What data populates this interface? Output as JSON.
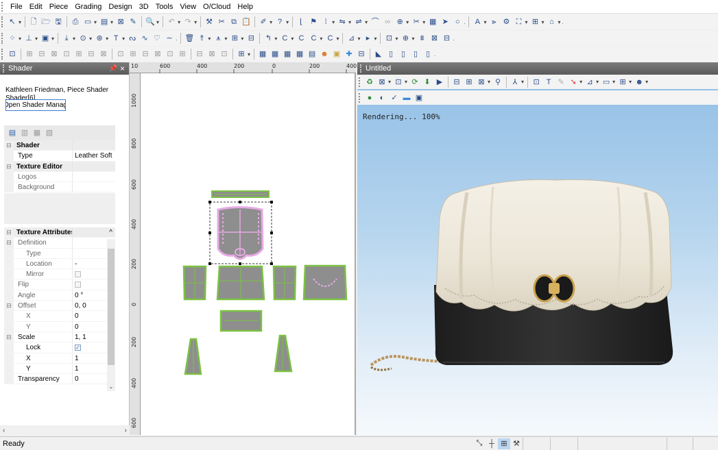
{
  "menu": {
    "items": [
      "File",
      "Edit",
      "Piece",
      "Grading",
      "Design",
      "3D",
      "Tools",
      "View",
      "O/Cloud",
      "Help"
    ]
  },
  "shader_panel": {
    "title": "Shader",
    "pin_icon": "pin-icon",
    "close_icon": "close-icon",
    "piece_title": "Kathleen Friedman, Piece Shader Shader[6]",
    "open_shader_value": "Open Shader Manager",
    "properties": {
      "shader_category": "Shader",
      "type_label": "Type",
      "type_value": "Leather Soft",
      "texture_editor_category": "Texture Editor",
      "logos_label": "Logos",
      "background_label": "Background"
    },
    "texture_attributes": {
      "category": "Texture Attributes",
      "definition": "Definition",
      "type": "Type",
      "location": "Location",
      "location_value": "-",
      "mirror": "Mirror",
      "flip": "Flip",
      "angle": "Angle",
      "angle_value": "0 °",
      "offset": "Offset",
      "offset_value": "0, 0",
      "offset_x": "X",
      "offset_x_value": "0",
      "offset_y": "Y",
      "offset_y_value": "0",
      "scale": "Scale",
      "scale_value": "1, 1",
      "lock": "Lock",
      "scale_x": "X",
      "scale_x_value": "1",
      "scale_y": "Y",
      "scale_y_value": "1",
      "transparency": "Transparency",
      "transparency_value": "0"
    }
  },
  "view2d": {
    "ruler_top_labels": [
      "10",
      "600",
      "400",
      "200",
      "0",
      "200",
      "400"
    ],
    "ruler_left_labels": [
      "1000",
      "800",
      "600",
      "400",
      "200",
      "0",
      "200",
      "400",
      "600"
    ]
  },
  "view3d": {
    "title": "Untitled",
    "render_status": "Rendering... 100%"
  },
  "status_bar": {
    "text": "Ready"
  },
  "colors": {
    "panel_header": "#6a6a6a",
    "piece_fill": "#8e8e8e",
    "piece_outline": "#7cc242",
    "selection_pink": "#e7a9e4",
    "bag_flap": "#ece7dc",
    "bag_body": "#262626",
    "chain_gold": "#b8945a"
  }
}
